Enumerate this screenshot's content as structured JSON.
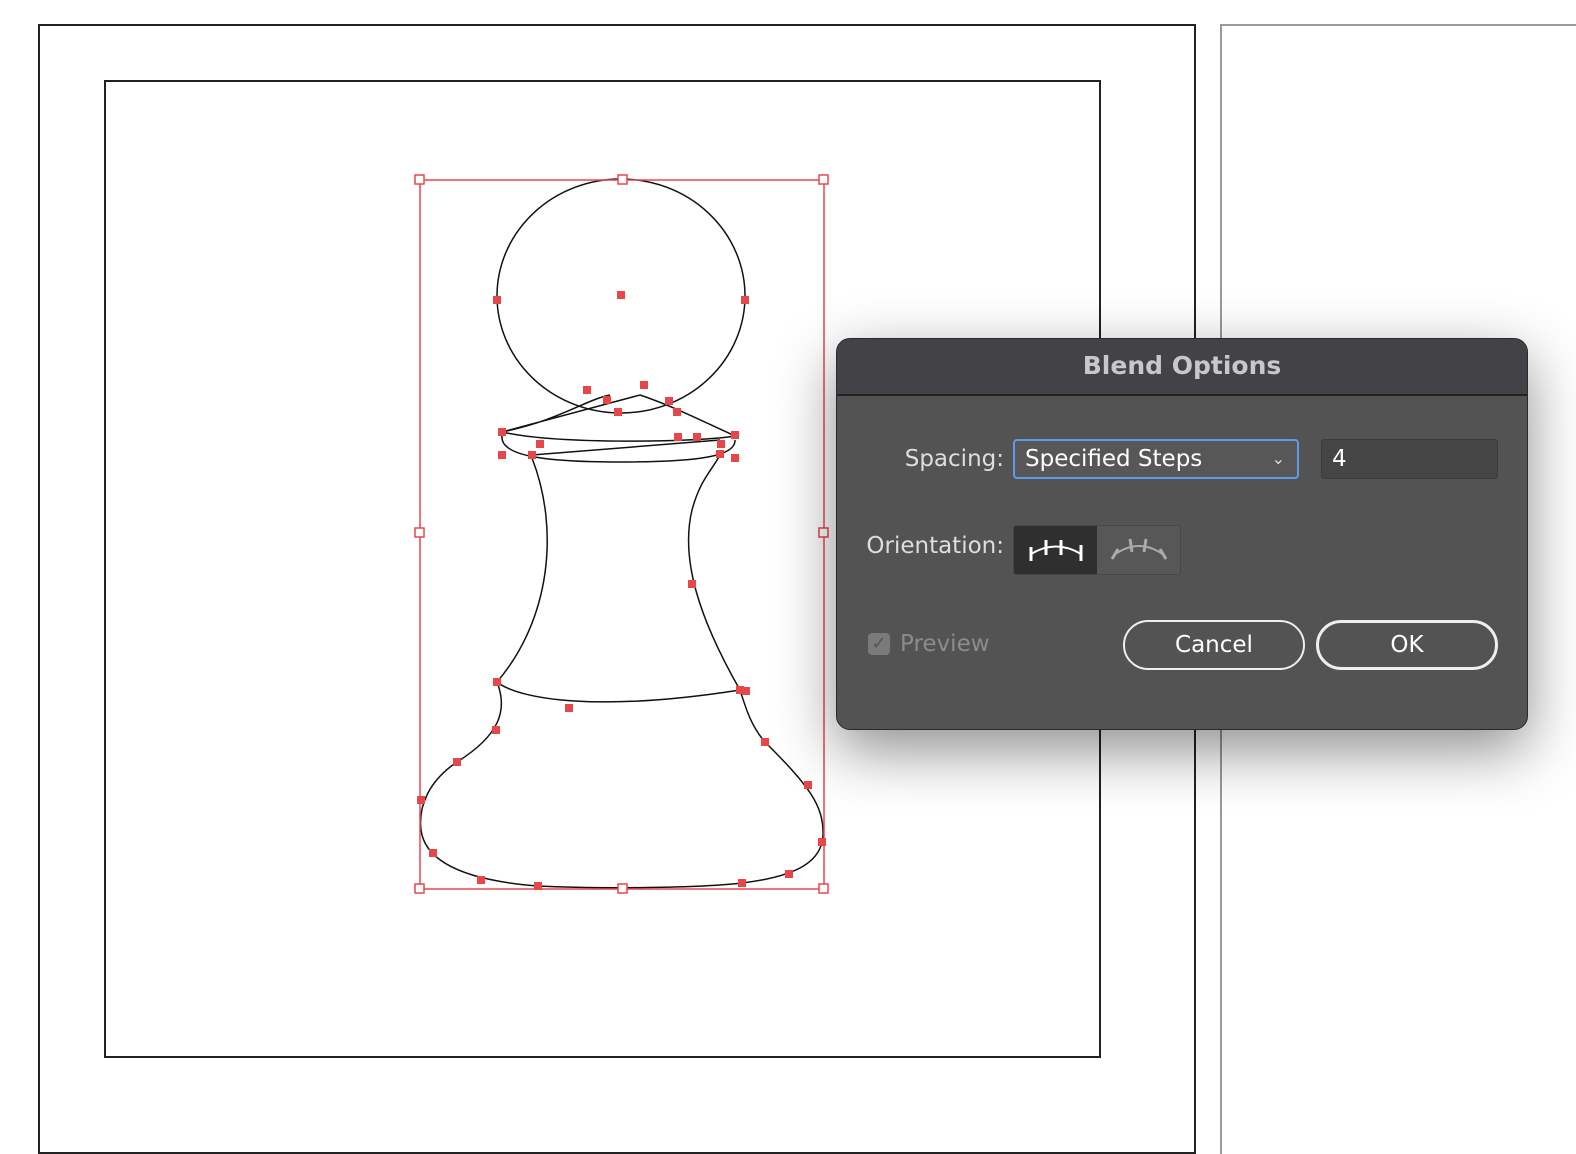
{
  "dialog": {
    "title": "Blend Options",
    "spacing_label": "Spacing:",
    "spacing_value": "Specified Steps",
    "steps_value": "4",
    "orientation_label": "Orientation:",
    "orientation_options": [
      "align-to-page-icon",
      "align-to-path-icon"
    ],
    "orientation_selected": "align-to-page-icon",
    "preview_label": "Preview",
    "preview_checked": true,
    "cancel_label": "Cancel",
    "ok_label": "OK"
  },
  "colors": {
    "selection": "#e8474a",
    "dialog_bg": "#535353",
    "title_bg": "#434347",
    "focus": "#5b9be8"
  }
}
